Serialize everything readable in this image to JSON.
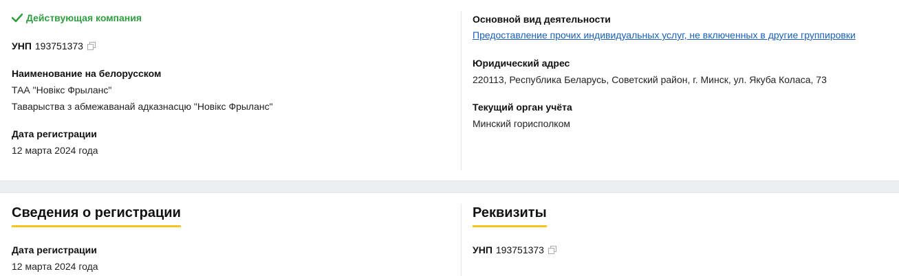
{
  "status": {
    "text": "Действующая компания",
    "color": "#2e9e3e"
  },
  "unp": {
    "label": "УНП",
    "value": "193751373"
  },
  "name_by": {
    "label": "Наименование на белорусском",
    "short": "ТАА \"Новікс Фрыланс\"",
    "full": "Таварыства з абмежаванай адказнасцю \"Новікс Фрыланс\""
  },
  "registration": {
    "label": "Дата регистрации",
    "value": "12 марта 2024 года"
  },
  "activity": {
    "label": "Основной вид деятельности",
    "value": "Предоставление прочих индивидуальных услуг, не включенных в другие группировки"
  },
  "address": {
    "label": "Юридический адрес",
    "value": "220113, Республика Беларусь, Советский район, г. Минск, ул. Якуба Коласа, 73"
  },
  "authority": {
    "label": "Текущий орган учёта",
    "value": "Минский горисполком"
  },
  "sections": {
    "reg_title": "Сведения о регистрации",
    "req_title": "Реквизиты"
  },
  "colors": {
    "accent": "#f5c518",
    "link": "#1a5fb4"
  }
}
